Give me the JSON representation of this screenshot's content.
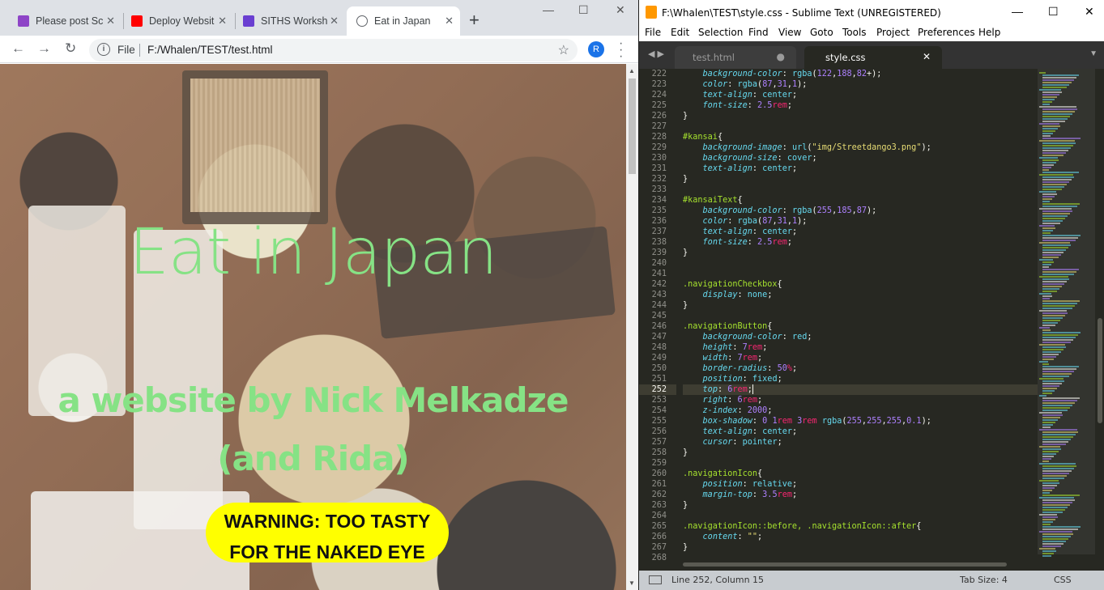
{
  "chrome": {
    "tabs": [
      {
        "title": "Please post Sc",
        "favicon_color": "#8e44c7"
      },
      {
        "title": "Deploy Websit",
        "favicon_color": "#ff0000"
      },
      {
        "title": "SITHS Worksh",
        "favicon_color": "#6a3fd1"
      },
      {
        "title": "Eat in Japan",
        "favicon_color": "#5f6368",
        "active": true
      }
    ],
    "new_tab": "+",
    "window_buttons": {
      "minimize": "—",
      "maximize": "☐",
      "close": "✕"
    },
    "nav": {
      "back": "←",
      "forward": "→",
      "reload": "↻"
    },
    "omnibox": {
      "info": "i",
      "scheme": "File",
      "url": "F:/Whalen/TEST/test.html",
      "star": "☆"
    },
    "profile_initial": "R",
    "menu": "⋮"
  },
  "page": {
    "title": "Eat in Japan",
    "subtitle_line1": "a website by Nick Melkadze",
    "subtitle_line2": "(and Rida)",
    "warning_line1": "WARNING: TOO TASTY",
    "warning_line2": "FOR THE NAKED EYE",
    "title_color": "#86e285",
    "warning_color": "#ffff00"
  },
  "sublime": {
    "title": "F:\\Whalen\\TEST\\style.css - Sublime Text (UNREGISTERED)",
    "window_buttons": {
      "minimize": "—",
      "maximize": "☐",
      "close": "✕"
    },
    "menu": [
      "File",
      "Edit",
      "Selection",
      "Find",
      "View",
      "Goto",
      "Tools",
      "Project",
      "Preferences",
      "Help"
    ],
    "tabs": [
      {
        "title": "test.html",
        "marker": "●"
      },
      {
        "title": "style.css",
        "marker": "✕",
        "active": true
      }
    ],
    "nav_arrows": "◀ ▶",
    "tab_dropdown": "▼",
    "status": {
      "position": "Line 252, Column 15",
      "tab_size": "Tab Size: 4",
      "syntax": "CSS"
    },
    "current_line": 252,
    "code_lines": [
      {
        "n": 222,
        "t": "    background-color: rgba(122,188,82+);"
      },
      {
        "n": 223,
        "t": "    color: rgba(87,31,1);"
      },
      {
        "n": 224,
        "t": "    text-align: center;"
      },
      {
        "n": 225,
        "t": "    font-size: 2.5rem;"
      },
      {
        "n": 226,
        "t": "}"
      },
      {
        "n": 227,
        "t": ""
      },
      {
        "n": 228,
        "t": "#kansai{"
      },
      {
        "n": 229,
        "t": "    background-image: url(\"img/Streetdango3.png\");"
      },
      {
        "n": 230,
        "t": "    background-size: cover;"
      },
      {
        "n": 231,
        "t": "    text-align: center;"
      },
      {
        "n": 232,
        "t": "}"
      },
      {
        "n": 233,
        "t": ""
      },
      {
        "n": 234,
        "t": "#kansaiText{"
      },
      {
        "n": 235,
        "t": "    background-color: rgba(255,185,87);"
      },
      {
        "n": 236,
        "t": "    color: rgba(87,31,1);"
      },
      {
        "n": 237,
        "t": "    text-align: center;"
      },
      {
        "n": 238,
        "t": "    font-size: 2.5rem;"
      },
      {
        "n": 239,
        "t": "}"
      },
      {
        "n": 240,
        "t": ""
      },
      {
        "n": 241,
        "t": ""
      },
      {
        "n": 242,
        "t": ".navigationCheckbox{"
      },
      {
        "n": 243,
        "t": "    display: none;"
      },
      {
        "n": 244,
        "t": "}"
      },
      {
        "n": 245,
        "t": ""
      },
      {
        "n": 246,
        "t": ".navigationButton{"
      },
      {
        "n": 247,
        "t": "    background-color: red;"
      },
      {
        "n": 248,
        "t": "    height: 7rem;"
      },
      {
        "n": 249,
        "t": "    width: 7rem;"
      },
      {
        "n": 250,
        "t": "    border-radius: 50%;"
      },
      {
        "n": 251,
        "t": "    position: fixed;"
      },
      {
        "n": 252,
        "t": "    top: 6rem;"
      },
      {
        "n": 253,
        "t": "    right: 6rem;"
      },
      {
        "n": 254,
        "t": "    z-index: 2000;"
      },
      {
        "n": 255,
        "t": "    box-shadow: 0 1rem 3rem rgba(255,255,255,0.1);"
      },
      {
        "n": 256,
        "t": "    text-align: center;"
      },
      {
        "n": 257,
        "t": "    cursor: pointer;"
      },
      {
        "n": 258,
        "t": "}"
      },
      {
        "n": 259,
        "t": ""
      },
      {
        "n": 260,
        "t": ".navigationIcon{"
      },
      {
        "n": 261,
        "t": "    position: relative;"
      },
      {
        "n": 262,
        "t": "    margin-top: 3.5rem;"
      },
      {
        "n": 263,
        "t": "}"
      },
      {
        "n": 264,
        "t": ""
      },
      {
        "n": 265,
        "t": ".navigationIcon::before, .navigationIcon::after{"
      },
      {
        "n": 266,
        "t": "    content: \"\";"
      },
      {
        "n": 267,
        "t": "}"
      },
      {
        "n": 268,
        "t": ""
      }
    ]
  }
}
